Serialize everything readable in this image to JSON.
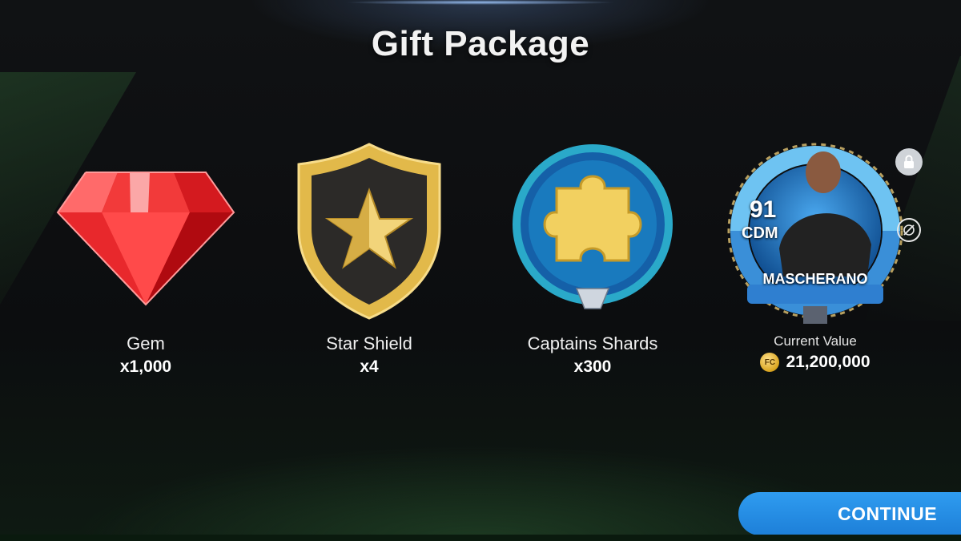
{
  "title": "Gift Package",
  "items": [
    {
      "name": "Gem",
      "qty": "x1,000",
      "icon": "red-gem-icon"
    },
    {
      "name": "Star Shield",
      "qty": "x4",
      "icon": "gold-star-shield-icon"
    },
    {
      "name": "Captains Shards",
      "qty": "x300",
      "icon": "puzzle-piece-badge-icon"
    }
  ],
  "player": {
    "rating": "91",
    "position": "CDM",
    "name": "MASCHERANO",
    "value_label": "Current Value",
    "value": "21,200,000",
    "badge_text": "FC"
  },
  "continue_label": "CONTINUE",
  "colors": {
    "accent": "#2f9cf0",
    "gold": "#e5b93a",
    "gem_red": "#e01a1a"
  }
}
